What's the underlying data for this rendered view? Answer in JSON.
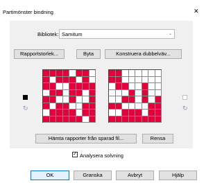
{
  "window": {
    "title": "Partimönster bindning",
    "close_glyph": "✕"
  },
  "library": {
    "label": "Bibliotek:",
    "value": "Samitum"
  },
  "buttons": {
    "report_size": "Rapportstorlek...",
    "swap": "Byta",
    "construct_double": "Konstruera dubbelväv...",
    "fetch_reports": "Hämta rapporter från sparad fil...",
    "clear": "Rensa",
    "ok": "OK",
    "preview": "Granska",
    "cancel": "Avbryt",
    "help": "Hjälp"
  },
  "analyze": {
    "label": "Analysera solvning",
    "checked": true,
    "check_glyph": "✓"
  },
  "colors": {
    "warp": "#000000",
    "weft": "#ffffff",
    "accent": "#e4003a"
  },
  "icons": {
    "left_swatch": "black-swatch-icon",
    "right_swatch": "white-swatch-icon",
    "refresh": "refresh-icon"
  },
  "left_pattern": [
    [
      1,
      1,
      1,
      1,
      0,
      1,
      1,
      0
    ],
    [
      1,
      0,
      1,
      1,
      1,
      0,
      1,
      0
    ],
    [
      1,
      1,
      0,
      0,
      1,
      1,
      1,
      1
    ],
    [
      0,
      1,
      1,
      0,
      1,
      1,
      0,
      1
    ],
    [
      1,
      1,
      0,
      0,
      1,
      0,
      0,
      1
    ],
    [
      1,
      0,
      1,
      1,
      0,
      0,
      1,
      1
    ],
    [
      0,
      1,
      1,
      1,
      1,
      0,
      1,
      1
    ],
    [
      1,
      1,
      1,
      1,
      1,
      1,
      0,
      1
    ]
  ],
  "right_pattern": [
    [
      1,
      1,
      0,
      0,
      0,
      0,
      0,
      0
    ],
    [
      1,
      1,
      0,
      0,
      0,
      0,
      0,
      0
    ],
    [
      0,
      1,
      1,
      0,
      0,
      1,
      0,
      0
    ],
    [
      0,
      0,
      0,
      1,
      0,
      1,
      0,
      0
    ],
    [
      0,
      0,
      1,
      1,
      0,
      1,
      0,
      1
    ],
    [
      1,
      1,
      0,
      0,
      0,
      0,
      1,
      1
    ],
    [
      0,
      0,
      1,
      1,
      1,
      0,
      1,
      1
    ],
    [
      1,
      1,
      1,
      1,
      1,
      1,
      1,
      1
    ]
  ]
}
